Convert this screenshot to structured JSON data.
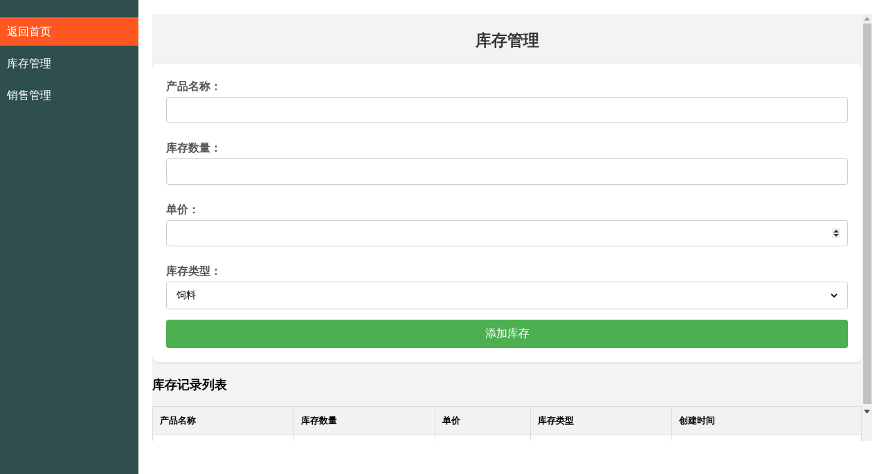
{
  "sidebar": {
    "items": [
      {
        "label": "返回首页",
        "selected": true
      },
      {
        "label": "库存管理",
        "selected": false
      },
      {
        "label": "销售管理",
        "selected": false
      }
    ]
  },
  "page": {
    "title": "库存管理"
  },
  "form": {
    "fields": [
      {
        "label": "产品名称：",
        "kind": "text"
      },
      {
        "label": "库存数量：",
        "kind": "text"
      },
      {
        "label": "单价：",
        "kind": "number"
      },
      {
        "label": "库存类型：",
        "kind": "select",
        "value": "饲料"
      }
    ],
    "submit": "添加库存"
  },
  "table": {
    "title": "库存记录列表",
    "columns": [
      "产品名称",
      "库存数量",
      "单价",
      "库存类型",
      "创建时间"
    ]
  }
}
